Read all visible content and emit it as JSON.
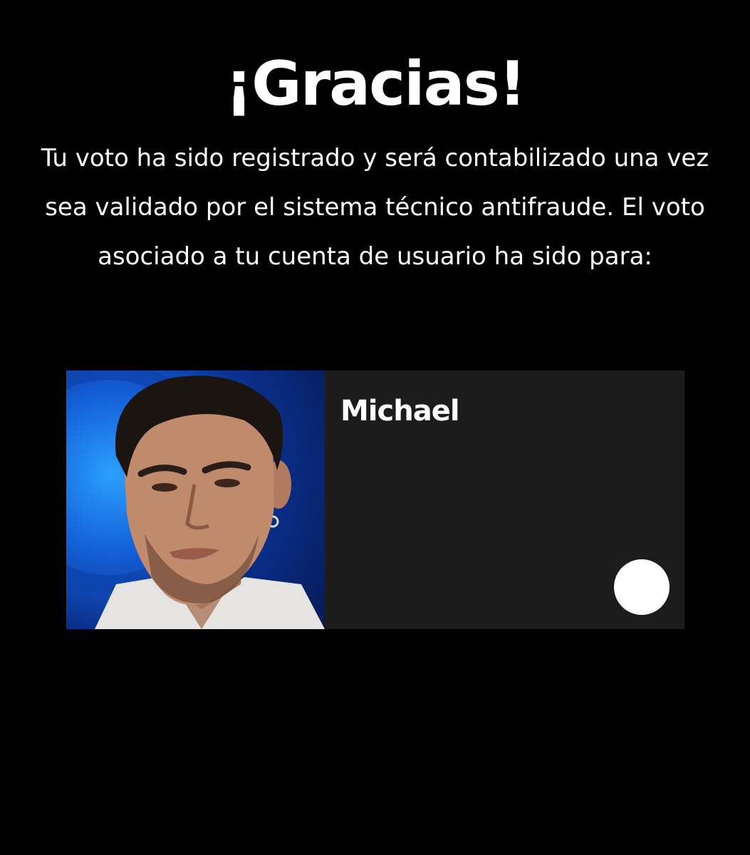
{
  "header": {
    "title": "¡Gracias!"
  },
  "message": {
    "text": "Tu voto ha sido registrado y será contabilizado una vez sea validado por el sistema técnico antifraude. El voto asociado a tu cuenta de usuario ha sido para:"
  },
  "candidate": {
    "name": "Michael",
    "photo": "candidate-portrait",
    "selected": true
  },
  "colors": {
    "background": "#000000",
    "card_background": "#1c1c1c",
    "text": "#ffffff",
    "photo_backdrop": "#1460d8"
  }
}
